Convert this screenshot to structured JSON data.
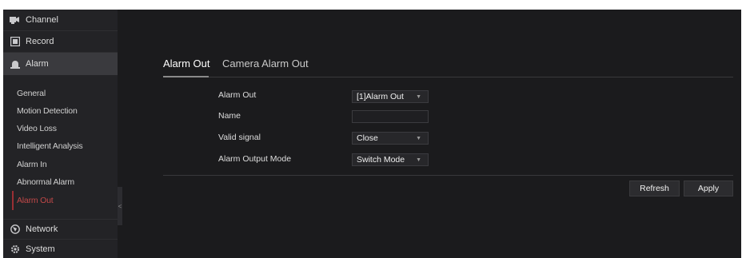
{
  "sidebar": {
    "top_items": [
      {
        "label": "Channel",
        "icon": "camera-icon"
      },
      {
        "label": "Record",
        "icon": "record-icon"
      },
      {
        "label": "Alarm",
        "icon": "alarm-icon"
      }
    ],
    "sub_items": [
      {
        "label": "General"
      },
      {
        "label": "Motion Detection"
      },
      {
        "label": "Video Loss"
      },
      {
        "label": "Intelligent Analysis"
      },
      {
        "label": "Alarm In"
      },
      {
        "label": "Abnormal Alarm"
      },
      {
        "label": "Alarm Out"
      }
    ],
    "bottom_items": [
      {
        "label": "Network",
        "icon": "network-icon"
      },
      {
        "label": "System",
        "icon": "system-gear-icon"
      }
    ],
    "collapse_glyph": "<"
  },
  "tabs": [
    {
      "label": "Alarm Out"
    },
    {
      "label": "Camera Alarm Out"
    }
  ],
  "form": {
    "alarm_out": {
      "label": "Alarm Out",
      "value": "[1]Alarm Out"
    },
    "name": {
      "label": "Name",
      "value": ""
    },
    "valid_signal": {
      "label": "Valid signal",
      "value": "Close"
    },
    "output_mode": {
      "label": "Alarm Output Mode",
      "value": "Switch Mode"
    }
  },
  "buttons": {
    "refresh": "Refresh",
    "apply": "Apply"
  },
  "colors": {
    "background": "#1b1b1d",
    "sidebar": "#232326",
    "active_accent": "#9a2f34",
    "active_text": "#c04848"
  }
}
